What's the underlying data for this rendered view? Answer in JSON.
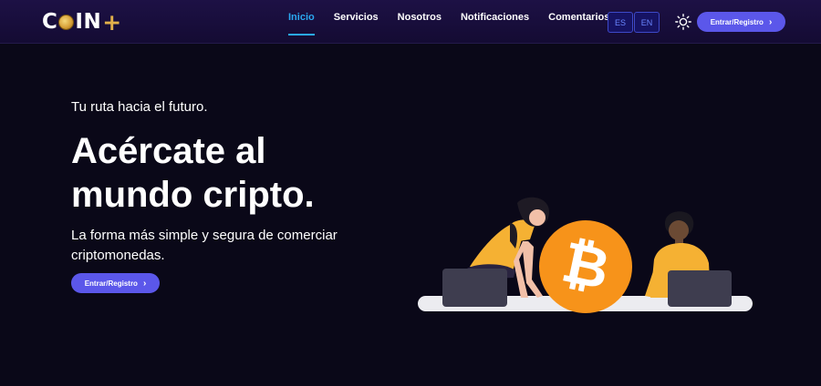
{
  "header": {
    "logo_prefix": "C",
    "logo_suffix": "IN",
    "logo_plus": "+",
    "nav": [
      {
        "label": "Inicio",
        "active": true
      },
      {
        "label": "Servicios",
        "active": false
      },
      {
        "label": "Nosotros",
        "active": false
      },
      {
        "label": "Notificaciones",
        "active": false
      },
      {
        "label": "Comentarios",
        "active": false
      }
    ],
    "languages": [
      "ES",
      "EN"
    ],
    "theme_icon": "sun-icon",
    "login_label": "Entrar/Registro",
    "login_icon": "chevron-right-icon"
  },
  "hero": {
    "tagline": "Tu ruta hacia el futuro.",
    "title_line1": "Acércate al",
    "title_line2": "mundo cripto.",
    "description": "La forma más simple y segura de comerciar criptomonedas.",
    "cta_label": "Entrar/Registro",
    "cta_icon": "chevron-right-icon",
    "bitcoin_symbol": "₿"
  },
  "colors": {
    "accent": "#5b57ea",
    "active_link": "#2aa8f0",
    "background": "#0a0818",
    "bitcoin": "#f7931a"
  }
}
